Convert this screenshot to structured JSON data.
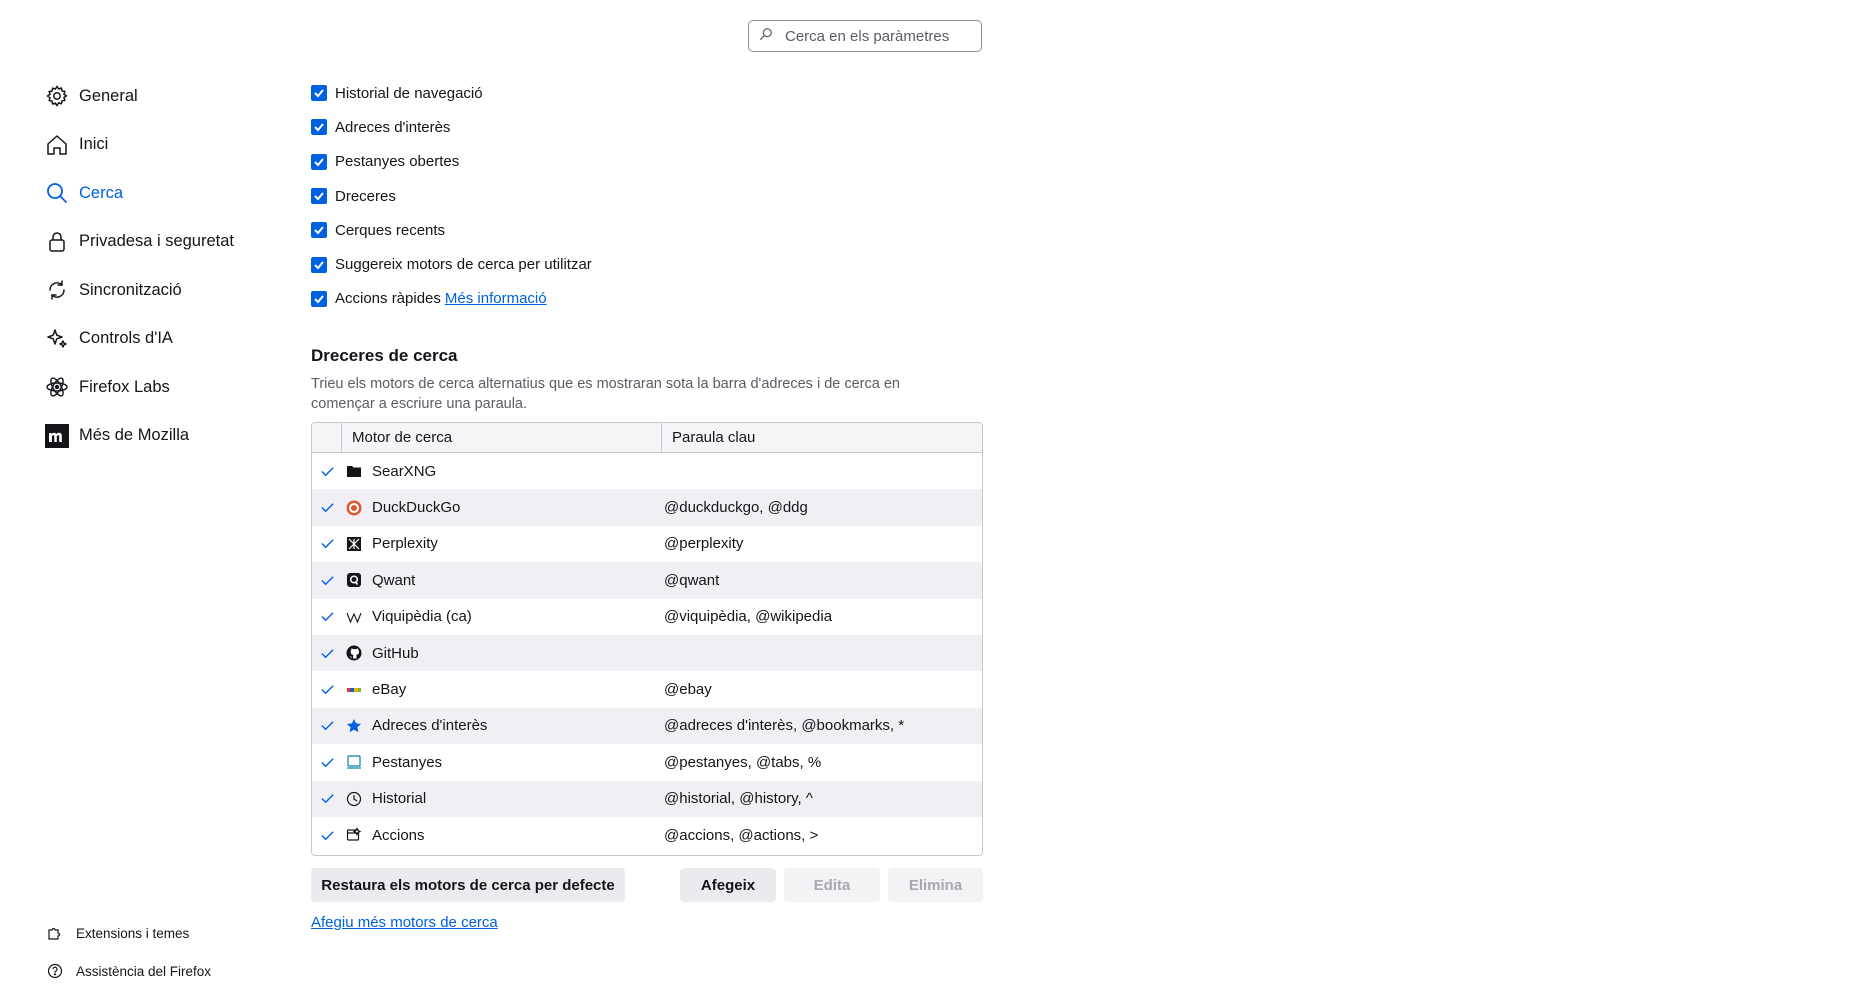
{
  "search": {
    "placeholder": "Cerca en els paràmetres"
  },
  "sidebar": {
    "items": [
      {
        "label": "General",
        "icon": "gear-icon"
      },
      {
        "label": "Inici",
        "icon": "home-icon"
      },
      {
        "label": "Cerca",
        "icon": "search-icon",
        "selected": true
      },
      {
        "label": "Privadesa i seguretat",
        "icon": "lock-icon"
      },
      {
        "label": "Sincronització",
        "icon": "sync-icon"
      },
      {
        "label": "Controls d'IA",
        "icon": "sparkle-icon"
      },
      {
        "label": "Firefox Labs",
        "icon": "flask-icon"
      },
      {
        "label": "Més de Mozilla",
        "icon": "mozilla-logo-icon"
      }
    ],
    "footer": [
      {
        "label": "Extensions i temes",
        "icon": "puzzle-icon"
      },
      {
        "label": "Assistència del Firefox",
        "icon": "help-icon"
      }
    ]
  },
  "suggestions": {
    "items": [
      {
        "label": "Historial de navegació",
        "checked": true
      },
      {
        "label": "Adreces d'interès",
        "checked": true
      },
      {
        "label": "Pestanyes obertes",
        "checked": true
      },
      {
        "label": "Dreceres",
        "checked": true
      },
      {
        "label": "Cerques recents",
        "checked": true
      },
      {
        "label": "Suggereix motors de cerca per utilitzar",
        "checked": true
      },
      {
        "label": "Accions ràpides",
        "checked": true
      }
    ],
    "more_info": "Més informació"
  },
  "shortcuts": {
    "title": "Dreceres de cerca",
    "description": "Trieu els motors de cerca alternatius que es mostraran sota la barra d'adreces i de cerca en començar a escriure una paraula.",
    "columns": {
      "engine": "Motor de cerca",
      "keyword": "Paraula clau"
    },
    "rows": [
      {
        "engine": "SearXNG",
        "keyword": "",
        "icon": "searxng-icon"
      },
      {
        "engine": "DuckDuckGo",
        "keyword": "@duckduckgo, @ddg",
        "icon": "duckduckgo-icon"
      },
      {
        "engine": "Perplexity",
        "keyword": "@perplexity",
        "icon": "perplexity-icon"
      },
      {
        "engine": "Qwant",
        "keyword": "@qwant",
        "icon": "qwant-icon"
      },
      {
        "engine": "Viquipèdia (ca)",
        "keyword": "@viquipèdia, @wikipedia",
        "icon": "wikipedia-icon"
      },
      {
        "engine": "GitHub",
        "keyword": "",
        "icon": "github-icon"
      },
      {
        "engine": "eBay",
        "keyword": "@ebay",
        "icon": "ebay-icon"
      },
      {
        "engine": "Adreces d'interès",
        "keyword": "@adreces d'interès, @bookmarks, *",
        "icon": "star-icon"
      },
      {
        "engine": "Pestanyes",
        "keyword": "@pestanyes, @tabs, %",
        "icon": "tab-icon"
      },
      {
        "engine": "Historial",
        "keyword": "@historial, @history, ^",
        "icon": "clock-icon"
      },
      {
        "engine": "Accions",
        "keyword": "@accions, @actions, >",
        "icon": "actions-icon"
      }
    ],
    "buttons": {
      "restore": "Restaura els motors de cerca per defecte",
      "add": "Afegeix",
      "edit": "Edita",
      "remove": "Elimina"
    },
    "more_engines_link": "Afegiu més motors de cerca"
  },
  "colors": {
    "accent": "#0061e0",
    "text": "#15141a",
    "muted": "#5b5b66"
  }
}
